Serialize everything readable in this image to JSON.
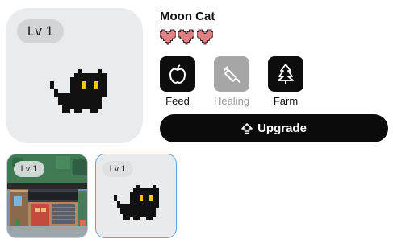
{
  "pet": {
    "name": "Moon Cat",
    "level": "Lv 1",
    "hearts": 3
  },
  "actions": [
    {
      "label": "Feed",
      "icon": "apple-icon",
      "enabled": true
    },
    {
      "label": "Healing",
      "icon": "syringe-icon",
      "enabled": false
    },
    {
      "label": "Farm",
      "icon": "tree-icon",
      "enabled": true
    }
  ],
  "upgrade": {
    "label": "Upgrade",
    "icon": "upgrade-arrow-icon"
  },
  "thumbnails": [
    {
      "level": "Lv 1",
      "kind": "house",
      "selected": false
    },
    {
      "level": "Lv 1",
      "kind": "cat",
      "selected": true
    }
  ],
  "colors": {
    "heart": "#e07f84",
    "button": "#0d0d0d",
    "disabled": "#a6a6a6",
    "cat_eye": "#f5c518",
    "selected_border": "#6aa4d8"
  }
}
